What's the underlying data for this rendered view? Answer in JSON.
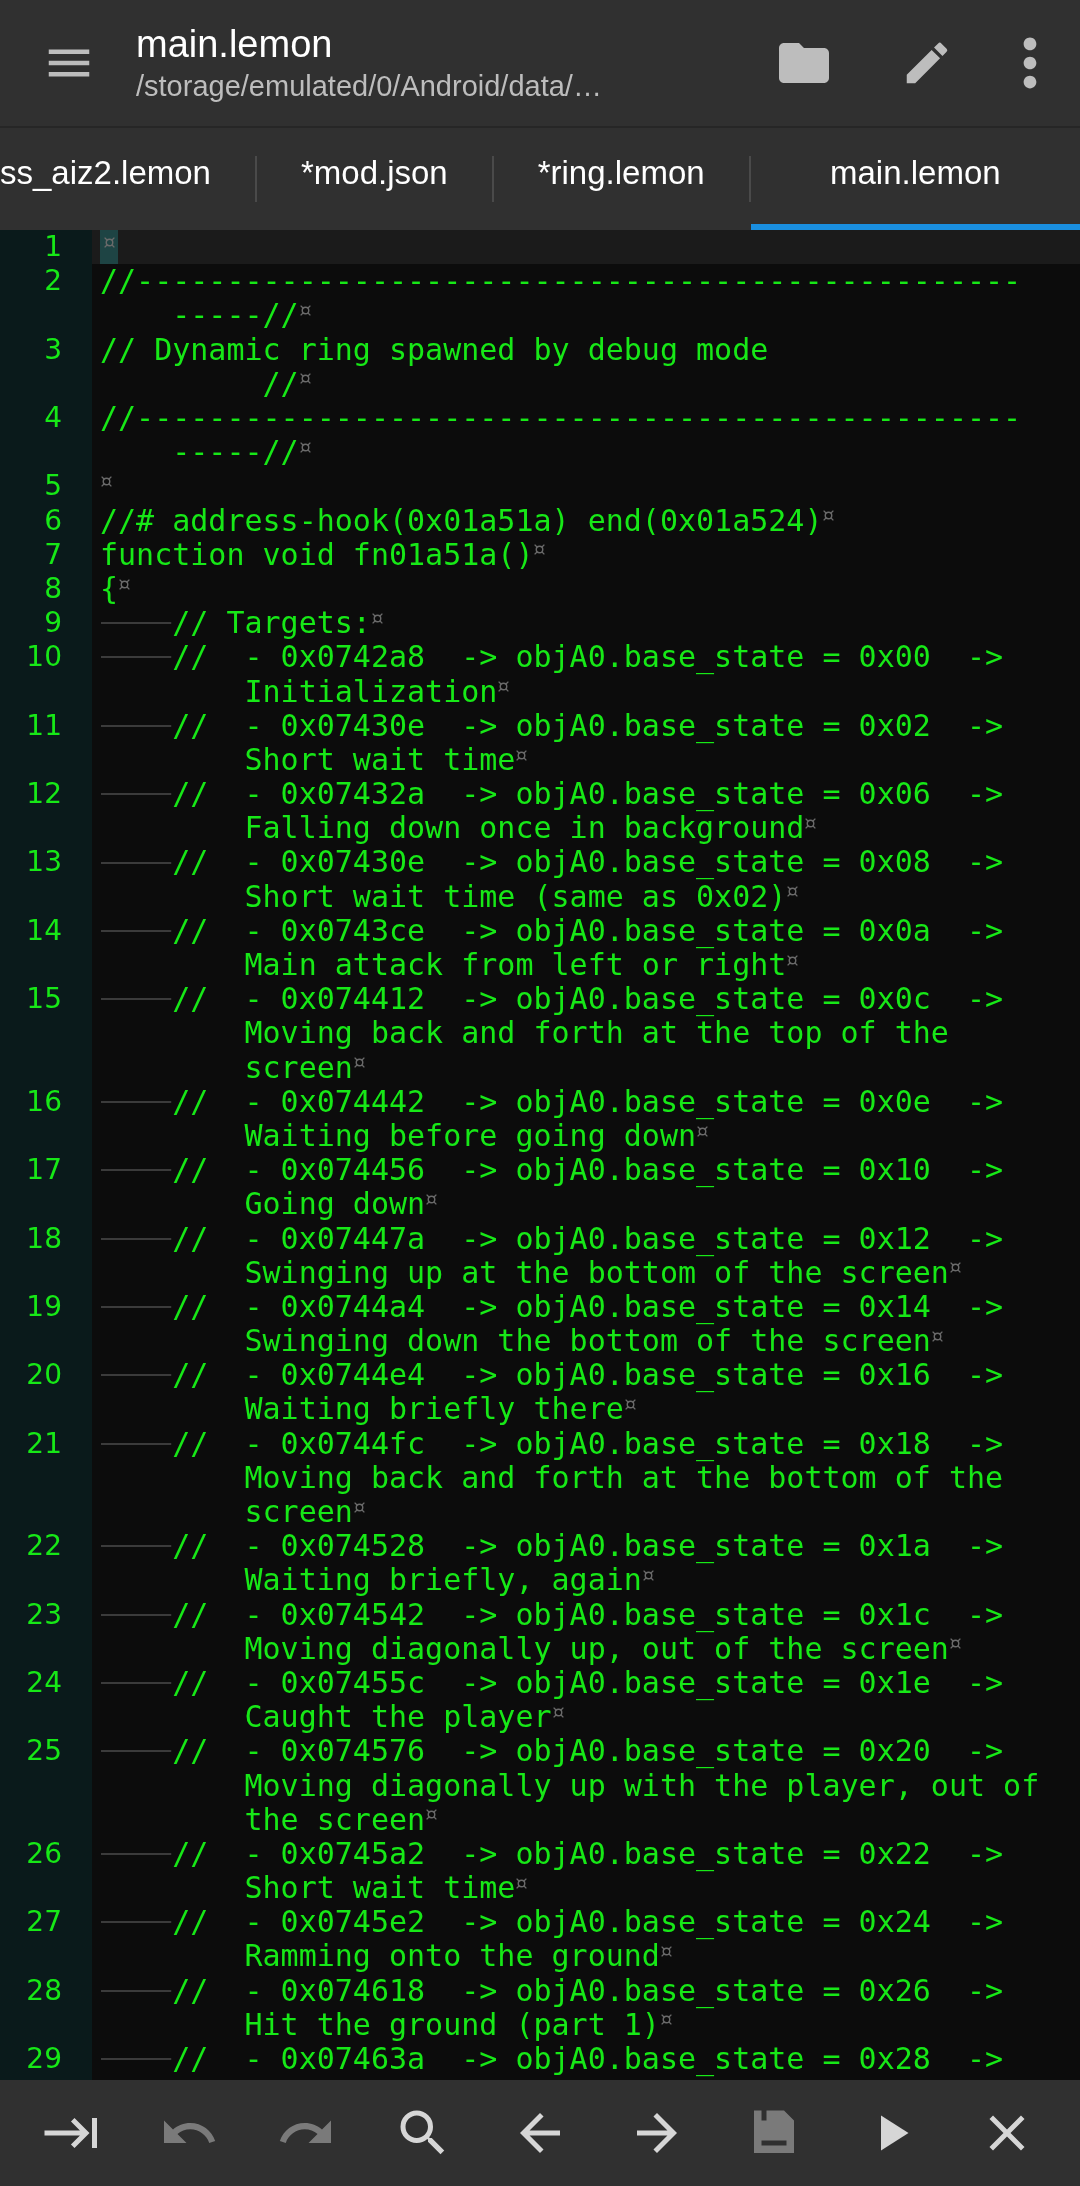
{
  "app_bar": {
    "title": "main.lemon",
    "path": "/storage/emulated/0/Android/data/…"
  },
  "tabs": [
    {
      "label": "ss_aiz2.lemon",
      "selected": false
    },
    {
      "label": "*mod.json",
      "selected": false
    },
    {
      "label": "*ring.lemon",
      "selected": false
    },
    {
      "label": "main.lemon",
      "selected": true
    }
  ],
  "editor": {
    "lines": [
      {
        "number": "1",
        "current": true,
        "tab": false,
        "eol": true
      },
      {
        "number": "2",
        "current": false,
        "tab": false,
        "eol": true,
        "rows": [
          "//-------------------------------------------------",
          "-----//"
        ]
      },
      {
        "number": "3",
        "current": false,
        "tab": false,
        "eol": true,
        "rows": [
          "// Dynamic ring spawned by debug mode",
          "     //"
        ]
      },
      {
        "number": "4",
        "current": false,
        "tab": false,
        "eol": true,
        "rows": [
          "//-------------------------------------------------",
          "-----//"
        ]
      },
      {
        "number": "5",
        "current": false,
        "tab": false,
        "eol": true
      },
      {
        "number": "6",
        "current": false,
        "tab": false,
        "eol": true,
        "rows": [
          "//# address-hook(0x01a51a) end(0x01a524)"
        ]
      },
      {
        "number": "7",
        "current": false,
        "tab": false,
        "eol": true,
        "rows": [
          "function void fn01a51a()"
        ]
      },
      {
        "number": "8",
        "current": false,
        "tab": false,
        "eol": true,
        "rows": [
          "{"
        ]
      },
      {
        "number": "9",
        "current": false,
        "tab": true,
        "eol": true,
        "rows": [
          "// Targets:"
        ]
      },
      {
        "number": "10",
        "current": false,
        "tab": true,
        "eol": true,
        "rows": [
          "//  - 0x0742a8\t-> objA0.base_state = 0x00  -> ",
          "Initialization"
        ]
      },
      {
        "number": "11",
        "current": false,
        "tab": true,
        "eol": true,
        "rows": [
          "//  - 0x07430e\t-> objA0.base_state = 0x02  -> ",
          "Short wait time"
        ]
      },
      {
        "number": "12",
        "current": false,
        "tab": true,
        "eol": true,
        "rows": [
          "//  - 0x07432a\t-> objA0.base_state = 0x06  -> ",
          "Falling down once in background"
        ]
      },
      {
        "number": "13",
        "current": false,
        "tab": true,
        "eol": true,
        "rows": [
          "//  - 0x07430e\t-> objA0.base_state = 0x08  -> ",
          "Short wait time (same as 0x02)"
        ]
      },
      {
        "number": "14",
        "current": false,
        "tab": true,
        "eol": true,
        "rows": [
          "//  - 0x0743ce\t-> objA0.base_state = 0x0a  -> ",
          "Main attack from left or right"
        ]
      },
      {
        "number": "15",
        "current": false,
        "tab": true,
        "eol": true,
        "rows": [
          "//  - 0x074412\t-> objA0.base_state = 0x0c  -> ",
          "Moving back and forth at the top of the ",
          "screen"
        ]
      },
      {
        "number": "16",
        "current": false,
        "tab": true,
        "eol": true,
        "rows": [
          "//  - 0x074442\t-> objA0.base_state = 0x0e  -> ",
          "Waiting before going down"
        ]
      },
      {
        "number": "17",
        "current": false,
        "tab": true,
        "eol": true,
        "rows": [
          "//  - 0x074456\t-> objA0.base_state = 0x10  -> ",
          "Going down"
        ]
      },
      {
        "number": "18",
        "current": false,
        "tab": true,
        "eol": true,
        "rows": [
          "//  - 0x07447a\t-> objA0.base_state = 0x12  -> ",
          "Swinging up at the bottom of the screen"
        ]
      },
      {
        "number": "19",
        "current": false,
        "tab": true,
        "eol": true,
        "rows": [
          "//  - 0x0744a4\t-> objA0.base_state = 0x14  -> ",
          "Swinging down the bottom of the screen"
        ]
      },
      {
        "number": "20",
        "current": false,
        "tab": true,
        "eol": true,
        "rows": [
          "//  - 0x0744e4\t-> objA0.base_state = 0x16  -> ",
          "Waiting briefly there"
        ]
      },
      {
        "number": "21",
        "current": false,
        "tab": true,
        "eol": true,
        "rows": [
          "//  - 0x0744fc\t-> objA0.base_state = 0x18  -> ",
          "Moving back and forth at the bottom of the ",
          "screen"
        ]
      },
      {
        "number": "22",
        "current": false,
        "tab": true,
        "eol": true,
        "rows": [
          "//  - 0x074528\t-> objA0.base_state = 0x1a  -> ",
          "Waiting briefly, again"
        ]
      },
      {
        "number": "23",
        "current": false,
        "tab": true,
        "eol": true,
        "rows": [
          "//  - 0x074542\t-> objA0.base_state = 0x1c  -> ",
          "Moving diagonally up, out of the screen"
        ]
      },
      {
        "number": "24",
        "current": false,
        "tab": true,
        "eol": true,
        "rows": [
          "//  - 0x07455c\t-> objA0.base_state = 0x1e  -> ",
          "Caught the player"
        ]
      },
      {
        "number": "25",
        "current": false,
        "tab": true,
        "eol": true,
        "rows": [
          "//  - 0x074576\t-> objA0.base_state = 0x20  -> ",
          "Moving diagonally up with the player, out of ",
          "the screen"
        ]
      },
      {
        "number": "26",
        "current": false,
        "tab": true,
        "eol": true,
        "rows": [
          "//  - 0x0745a2\t-> objA0.base_state = 0x22  -> ",
          "Short wait time"
        ]
      },
      {
        "number": "27",
        "current": false,
        "tab": true,
        "eol": true,
        "rows": [
          "//  - 0x0745e2\t-> objA0.base_state = 0x24  -> ",
          "Ramming onto the ground"
        ]
      },
      {
        "number": "28",
        "current": false,
        "tab": true,
        "eol": true,
        "rows": [
          "//  - 0x074618\t-> objA0.base_state = 0x26  -> ",
          "Hit the ground (part 1)"
        ]
      },
      {
        "number": "29",
        "current": false,
        "tab": true,
        "eol": false,
        "rows": [
          "//  - 0x07463a\t-> objA0.base_state = 0x28  -> "
        ]
      }
    ]
  },
  "toolbar": [
    {
      "kind": "indent",
      "disabled": false
    },
    {
      "kind": "undo",
      "disabled": true
    },
    {
      "kind": "redo",
      "disabled": true
    },
    {
      "kind": "search",
      "disabled": false
    },
    {
      "kind": "back",
      "disabled": false
    },
    {
      "kind": "forward",
      "disabled": false
    },
    {
      "kind": "save",
      "disabled": true
    },
    {
      "kind": "run",
      "disabled": false
    },
    {
      "kind": "close",
      "disabled": false
    }
  ]
}
